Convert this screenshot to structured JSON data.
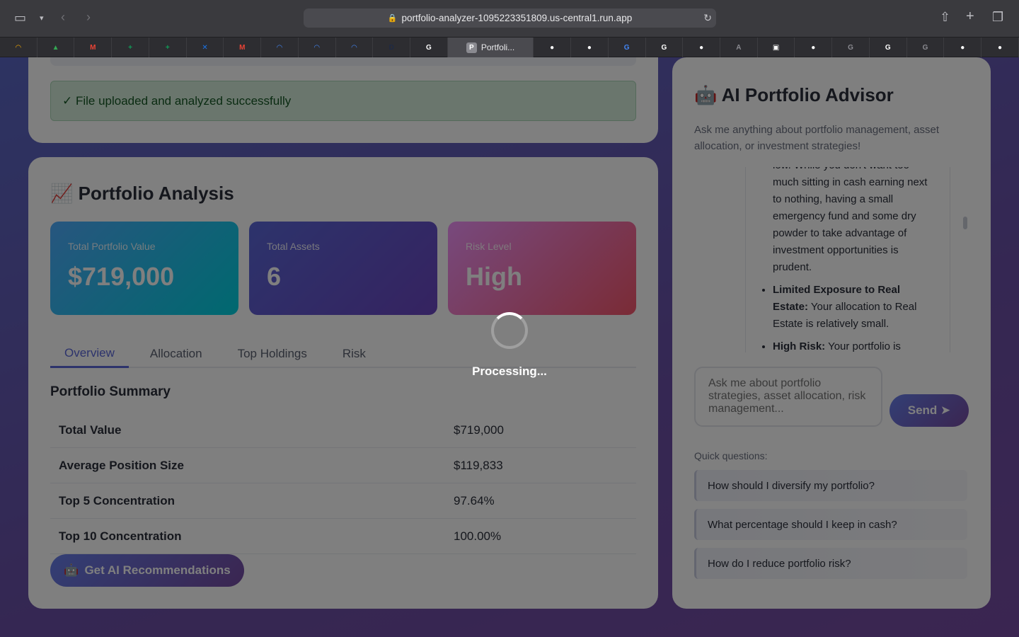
{
  "browser": {
    "url": "portfolio-analyzer-1095223351809.us-central1.run.app",
    "active_tab_label": "Portfoli...",
    "bookmarks": [
      {
        "icon": "google-cloud-icon",
        "color": "#f9ab00",
        "glyph": "◠"
      },
      {
        "icon": "google-drive-icon",
        "color": "#34a853",
        "glyph": "▲"
      },
      {
        "icon": "gmail-icon",
        "color": "#ea4335",
        "glyph": "M"
      },
      {
        "icon": "google-sheets-icon",
        "color": "#0f9d58",
        "glyph": "+"
      },
      {
        "icon": "google-sheets-icon",
        "color": "#0f9d58",
        "glyph": "+"
      },
      {
        "icon": "mail-icon",
        "color": "#1a73e8",
        "glyph": "✕"
      },
      {
        "icon": "gmail-icon",
        "color": "#ea4335",
        "glyph": "M"
      },
      {
        "icon": "google-cloud-icon",
        "color": "#4285f4",
        "glyph": "◠"
      },
      {
        "icon": "google-cloud-icon",
        "color": "#4285f4",
        "glyph": "◠"
      },
      {
        "icon": "google-cloud-icon",
        "color": "#4285f4",
        "glyph": "◠"
      },
      {
        "icon": "d-app-icon",
        "color": "#1f2a44",
        "glyph": "D"
      },
      {
        "icon": "google-icon",
        "color": "#ffffff",
        "glyph": "G"
      },
      {
        "icon": "active-tab",
        "color": "#8a8a90",
        "glyph": "P"
      },
      {
        "icon": "github-icon",
        "color": "#ffffff",
        "glyph": "●"
      },
      {
        "icon": "github-icon",
        "color": "#ffffff",
        "glyph": "●"
      },
      {
        "icon": "google-icon",
        "color": "#4285f4",
        "glyph": "G"
      },
      {
        "icon": "google-icon",
        "color": "#ffffff",
        "glyph": "G"
      },
      {
        "icon": "github-icon",
        "color": "#ffffff",
        "glyph": "●"
      },
      {
        "icon": "a-app-icon",
        "color": "#8a8a90",
        "glyph": "A"
      },
      {
        "icon": "frame-app-icon",
        "color": "#ffffff",
        "glyph": "▣"
      },
      {
        "icon": "github-icon",
        "color": "#ffffff",
        "glyph": "●"
      },
      {
        "icon": "g-app-icon",
        "color": "#8a8a90",
        "glyph": "G"
      },
      {
        "icon": "google-icon",
        "color": "#ffffff",
        "glyph": "G"
      },
      {
        "icon": "g-app-icon",
        "color": "#8a8a90",
        "glyph": "G"
      },
      {
        "icon": "github-icon",
        "color": "#ffffff",
        "glyph": "●"
      },
      {
        "icon": "github-icon",
        "color": "#ffffff",
        "glyph": "●"
      }
    ]
  },
  "upload": {
    "success_message": "✓ File uploaded and analyzed successfully"
  },
  "analysis": {
    "title": "📈 Portfolio Analysis",
    "stats": [
      {
        "label": "Total Portfolio Value",
        "value": "$719,000"
      },
      {
        "label": "Total Assets",
        "value": "6"
      },
      {
        "label": "Risk Level",
        "value": "High"
      }
    ],
    "tabs": [
      "Overview",
      "Allocation",
      "Top Holdings",
      "Risk"
    ],
    "active_tab": "Overview",
    "summary_title": "Portfolio Summary",
    "summary_rows": [
      {
        "key": "Total Value",
        "value": "$719,000"
      },
      {
        "key": "Average Position Size",
        "value": "$119,833"
      },
      {
        "key": "Top 5 Concentration",
        "value": "97.64%"
      },
      {
        "key": "Top 10 Concentration",
        "value": "100.00%"
      }
    ],
    "ai_button_label": "Get AI Recommendations",
    "ai_button_icon": "🤖"
  },
  "advisor": {
    "title": "🤖 AI Portfolio Advisor",
    "subtitle": "Ask me anything about portfolio management, asset allocation, or investment strategies!",
    "chat": {
      "partial_text": "low. While you don't want too much sitting in cash earning next to nothing, having a small emergency fund and some dry powder to take advantage of investment opportunities is prudent.",
      "bullets": [
        {
          "bold": "Limited Exposure to Real Estate:",
          "text": " Your allocation to Real Estate is relatively small."
        },
        {
          "bold": "High Risk:",
          "text": " Your portfolio is"
        }
      ]
    },
    "input_placeholder": "Ask me about portfolio strategies, asset allocation, risk management...",
    "send_label": "Send ➤",
    "quick_label": "Quick questions:",
    "quick_questions": [
      "How should I diversify my portfolio?",
      "What percentage should I keep in cash?",
      "How do I reduce portfolio risk?"
    ]
  },
  "overlay": {
    "processing_text": "Processing..."
  }
}
